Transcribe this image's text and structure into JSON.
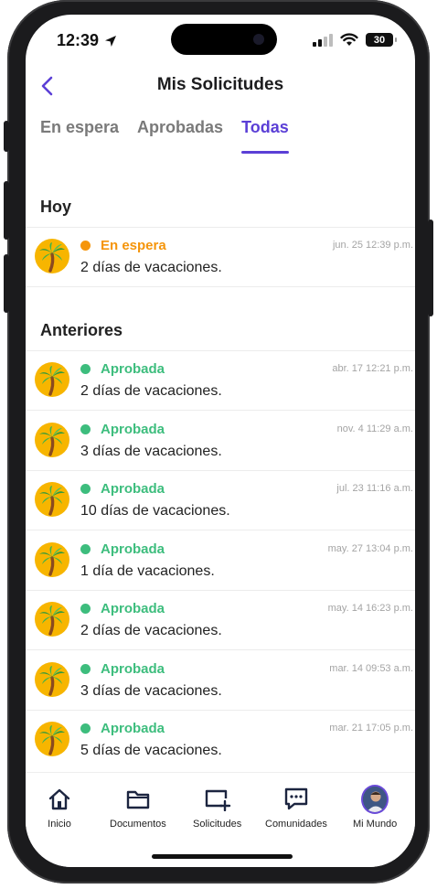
{
  "status_bar": {
    "time": "12:39",
    "battery": "30"
  },
  "header": {
    "title": "Mis Solicitudes"
  },
  "tabs": [
    {
      "label": "En espera",
      "active": false
    },
    {
      "label": "Aprobadas",
      "active": false
    },
    {
      "label": "Todas",
      "active": true
    }
  ],
  "sections": {
    "today": {
      "title": "Hoy"
    },
    "previous": {
      "title": "Anteriores"
    }
  },
  "today_items": [
    {
      "status": "En espera",
      "status_color": "#f5950b",
      "description": "2 días de vacaciones.",
      "date": "jun. 25 12:39 p.m.",
      "icon": "palm-tree-icon"
    }
  ],
  "previous_items": [
    {
      "status": "Aprobada",
      "status_color": "#3dbd7d",
      "description": "2 días de vacaciones.",
      "date": "abr. 17 12:21 p.m.",
      "icon": "palm-tree-icon"
    },
    {
      "status": "Aprobada",
      "status_color": "#3dbd7d",
      "description": "3 días de vacaciones.",
      "date": "nov. 4 11:29 a.m.",
      "icon": "palm-tree-icon"
    },
    {
      "status": "Aprobada",
      "status_color": "#3dbd7d",
      "description": "10 días de vacaciones.",
      "date": "jul. 23 11:16 a.m.",
      "icon": "palm-tree-icon"
    },
    {
      "status": "Aprobada",
      "status_color": "#3dbd7d",
      "description": "1 día de vacaciones.",
      "date": "may. 27 13:04 p.m.",
      "icon": "palm-tree-icon"
    },
    {
      "status": "Aprobada",
      "status_color": "#3dbd7d",
      "description": "2 días de vacaciones.",
      "date": "may. 14 16:23 p.m.",
      "icon": "palm-tree-icon"
    },
    {
      "status": "Aprobada",
      "status_color": "#3dbd7d",
      "description": "3 días de vacaciones.",
      "date": "mar. 14 09:53 a.m.",
      "icon": "palm-tree-icon"
    },
    {
      "status": "Aprobada",
      "status_color": "#3dbd7d",
      "description": "5 días de vacaciones.",
      "date": "mar. 21 17:05 p.m.",
      "icon": "palm-tree-icon"
    }
  ],
  "bottom_nav": [
    {
      "label": "Inicio",
      "icon": "home-icon"
    },
    {
      "label": "Documentos",
      "icon": "folder-icon"
    },
    {
      "label": "Solicitudes",
      "icon": "add-request-icon"
    },
    {
      "label": "Comunidades",
      "icon": "chat-icon"
    },
    {
      "label": "Mi Mundo",
      "icon": "profile-avatar"
    }
  ],
  "colors": {
    "accent": "#5b3fd6",
    "pending": "#f5950b",
    "approved": "#3dbd7d"
  }
}
